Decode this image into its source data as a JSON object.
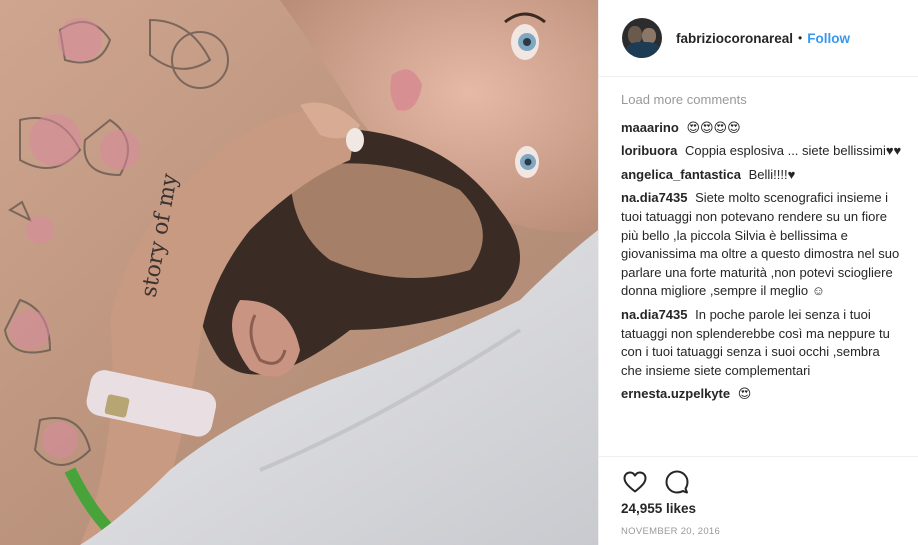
{
  "post": {
    "author": "fabriziocoronareal",
    "separator": "•",
    "follow_label": "Follow"
  },
  "comments": {
    "load_more": "Load more comments",
    "items": [
      {
        "user": "maaarino",
        "text": "😍😍😍😍"
      },
      {
        "user": "loribuora",
        "text": "Coppia esplosiva ... siete bellissimi♥♥"
      },
      {
        "user": "angelica_fantastica",
        "text": "Belli!!!!♥"
      },
      {
        "user": "na.dia7435",
        "text": "Siete molto scenografici insieme i tuoi tatuaggi non potevano rendere su un fiore più bello ,la piccola Silvia è bellissima e giovanissima ma oltre a questo dimostra nel suo parlare una forte maturità ,non potevi sciogliere donna migliore ,sempre il meglio ☺"
      },
      {
        "user": "na.dia7435",
        "text": "In poche parole lei senza i tuoi tatuaggi non splenderebbe così ma neppure tu con i tuoi tatuaggi senza i suoi occhi ,sembra che insieme siete complementari"
      },
      {
        "user": "ernesta.uzpelkyte",
        "text": "😍"
      }
    ]
  },
  "actions": {
    "likes": "24,955 likes",
    "date": "NOVEMBER 20, 2016",
    "like_icon": "heart-icon",
    "comment_icon": "comment-bubble-icon"
  },
  "colors": {
    "link": "#3897f0",
    "muted": "#999999",
    "text": "#262626",
    "border": "#efefef"
  }
}
